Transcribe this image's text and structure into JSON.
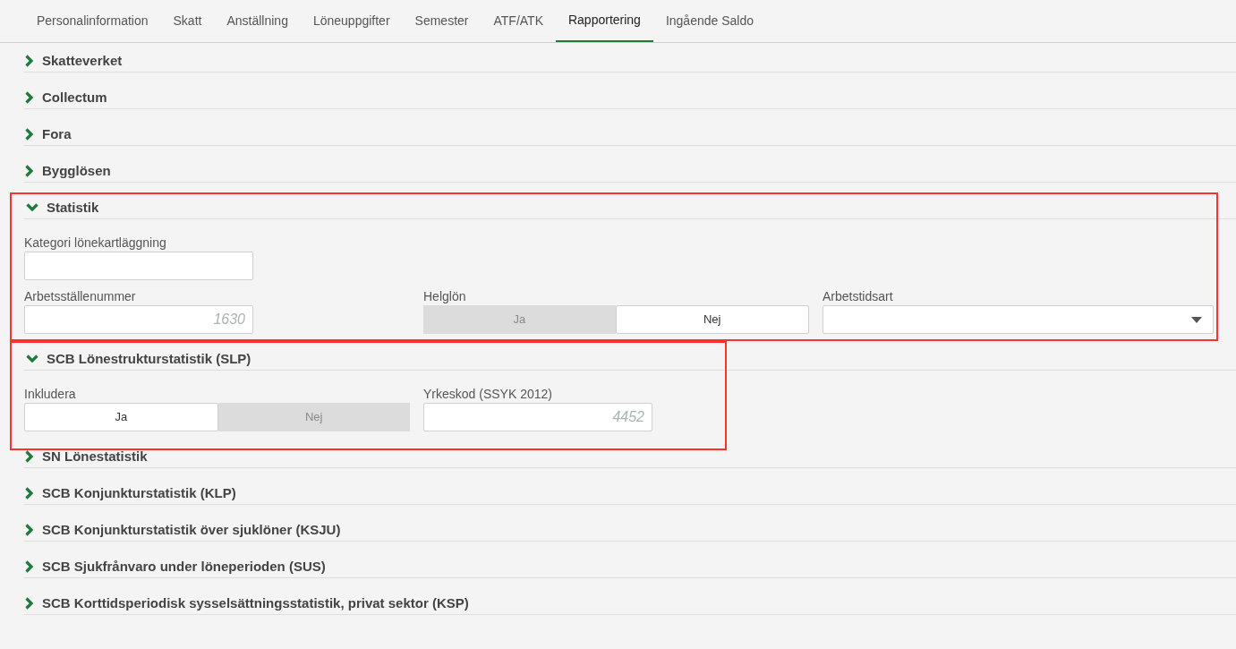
{
  "tabs": [
    {
      "label": "Personalinformation",
      "selected": false
    },
    {
      "label": "Skatt",
      "selected": false
    },
    {
      "label": "Anställning",
      "selected": false
    },
    {
      "label": "Löneuppgifter",
      "selected": false
    },
    {
      "label": "Semester",
      "selected": false
    },
    {
      "label": "ATF/ATK",
      "selected": false
    },
    {
      "label": "Rapportering",
      "selected": true
    },
    {
      "label": "Ingående Saldo",
      "selected": false
    }
  ],
  "sections": [
    {
      "title": "Skatteverket",
      "expanded": false,
      "highlighted": false
    },
    {
      "title": "Collectum",
      "expanded": false,
      "highlighted": false
    },
    {
      "title": "Fora",
      "expanded": false,
      "highlighted": false
    },
    {
      "title": "Bygglösen",
      "expanded": false,
      "highlighted": false
    },
    {
      "title": "Statistik",
      "expanded": true,
      "highlighted": true,
      "rows": [
        {
          "fields": [
            {
              "kind": "text",
              "label": "Kategori lönekartläggning"
            }
          ]
        },
        {
          "fields": [
            {
              "kind": "text",
              "label": "Arbetsställenummer",
              "placeholder": "1630"
            },
            {
              "kind": "toggle",
              "label": "Helglön",
              "options": [
                {
                  "label": "Ja",
                  "selected": false
                },
                {
                  "label": "Nej",
                  "selected": true
                }
              ]
            },
            {
              "kind": "select",
              "label": "Arbetstidsart"
            }
          ]
        }
      ]
    },
    {
      "title": "SCB Lönestrukturstatistik (SLP)",
      "expanded": true,
      "highlighted": true,
      "rows": [
        {
          "fields": [
            {
              "kind": "toggle",
              "label": "Inkludera",
              "options": [
                {
                  "label": "Ja",
                  "selected": true
                },
                {
                  "label": "Nej",
                  "selected": false
                }
              ]
            },
            {
              "kind": "text",
              "label": "Yrkeskod (SSYK 2012)",
              "placeholder": "4452"
            }
          ]
        }
      ]
    },
    {
      "title": "SN Lönestatistik",
      "expanded": false,
      "highlighted": false
    },
    {
      "title": "SCB Konjunkturstatistik (KLP)",
      "expanded": false,
      "highlighted": false
    },
    {
      "title": "SCB Konjunkturstatistik över sjuklöner (KSJU)",
      "expanded": false,
      "highlighted": false
    },
    {
      "title": "SCB Sjukfrånvaro under löneperioden (SUS)",
      "expanded": false,
      "highlighted": false
    },
    {
      "title": "SCB Korttidsperiodisk sysselsättningsstatistik, privat sektor (KSP)",
      "expanded": false,
      "highlighted": false
    }
  ]
}
